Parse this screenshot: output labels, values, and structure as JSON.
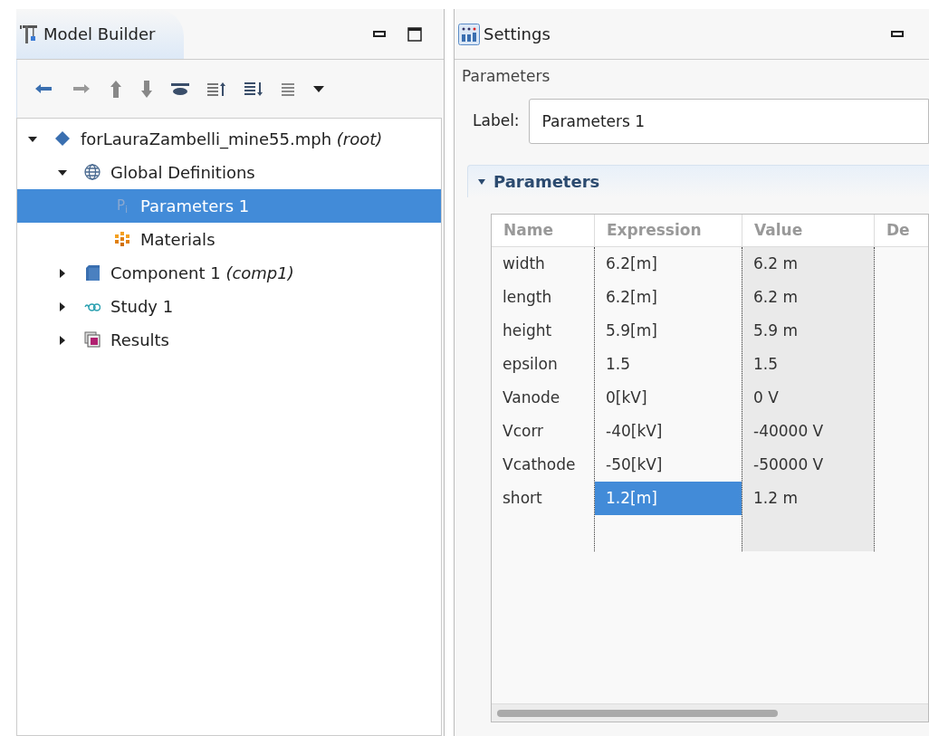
{
  "model_builder": {
    "title": "Model Builder",
    "tree": [
      {
        "label": "forLauraZambelli_mine55.mph *(root)*",
        "kind": "file",
        "expanded": true,
        "selected": false,
        "children": [
          {
            "label": "Global Definitions",
            "kind": "globe",
            "expanded": true,
            "selected": false,
            "children": [
              {
                "label": "Parameters 1",
                "kind": "parameters",
                "badge": "P$_{i}$",
                "selected": true
              },
              {
                "label": "Materials",
                "kind": "materials",
                "selected": false
              }
            ]
          },
          {
            "label": "Component 1 *(comp1)*",
            "kind": "component",
            "expanded": false,
            "selected": false
          },
          {
            "label": "Study 1",
            "kind": "study",
            "expanded": false,
            "selected": false
          },
          {
            "label": "Results",
            "kind": "results",
            "expanded": false,
            "selected": false
          }
        ]
      }
    ]
  },
  "settings": {
    "title": "Settings",
    "heading": "Parameters",
    "label_field": {
      "label": "Label:",
      "value": "Parameters 1"
    },
    "section": {
      "title": "Parameters",
      "expanded": true
    },
    "table": {
      "columns": [
        "Name",
        "Expression",
        "Value",
        "De"
      ],
      "rows": [
        {
          "name": "width",
          "expression": "6.2[m]",
          "value": "6.2 m",
          "selected": false
        },
        {
          "name": "length",
          "expression": "6.2[m]",
          "value": "6.2 m",
          "selected": false
        },
        {
          "name": "height",
          "expression": "5.9[m]",
          "value": "5.9 m",
          "selected": false
        },
        {
          "name": "epsilon",
          "expression": "1.5",
          "value": "1.5",
          "selected": false
        },
        {
          "name": "Vanode",
          "expression": "0[kV]",
          "value": "0 V",
          "selected": false
        },
        {
          "name": "Vcorr",
          "expression": "-40[kV]",
          "value": "-40000 V",
          "selected": false
        },
        {
          "name": "Vcathode",
          "expression": "-50[kV]",
          "value": "-50000 V",
          "selected": false
        },
        {
          "name": "short",
          "expression": "1.2[m]",
          "value": "1.2 m",
          "selected": true
        }
      ]
    }
  }
}
